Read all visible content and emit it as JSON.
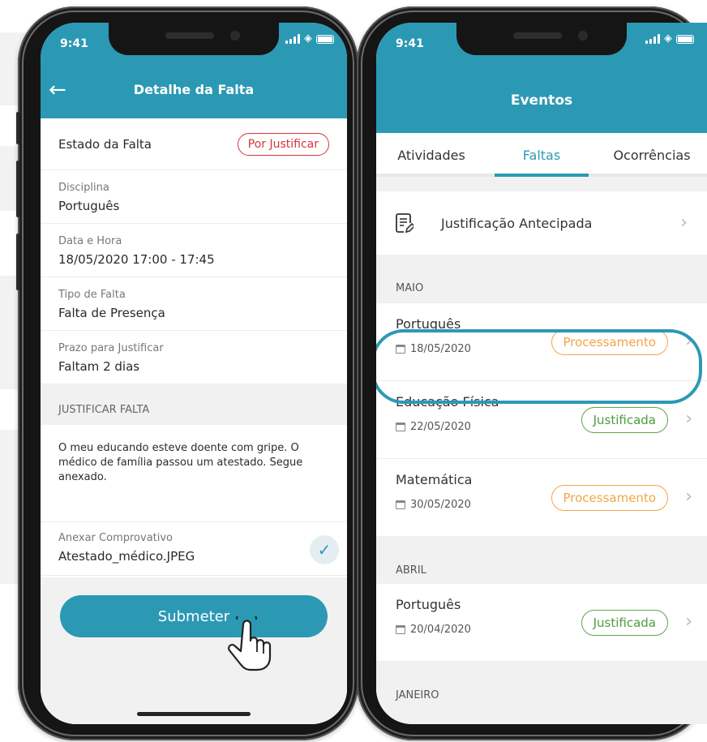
{
  "left_phone": {
    "status_time": "9:41",
    "header": {
      "back_icon": "arrow-left-icon",
      "title": "Detalhe da Falta"
    },
    "estado": {
      "label": "Estado da Falta",
      "badge": "Por Justificar",
      "badge_color": "#d6333f"
    },
    "fields": [
      {
        "label": "Disciplina",
        "value": "Português"
      },
      {
        "label": "Data e Hora",
        "value": "18/05/2020  17:00 - 17:45"
      },
      {
        "label": "Tipo de Falta",
        "value": "Falta de Presença"
      },
      {
        "label": "Prazo para Justificar",
        "value": "Faltam 2 dias"
      }
    ],
    "section_title": "JUSTIFICAR FALTA",
    "justification_text": "O meu educando esteve doente com gripe. O médico de família passou um atestado. Segue anexado.",
    "attachment": {
      "label": "Anexar Comprovativo",
      "value": "Atestado_médico.JPEG",
      "icon": "check-icon"
    },
    "submit_label": "Submeter"
  },
  "right_phone": {
    "status_time": "9:41",
    "header": {
      "title": "Eventos"
    },
    "tabs": [
      {
        "label": "Atividades"
      },
      {
        "label": "Faltas"
      },
      {
        "label": "Ocorrências"
      }
    ],
    "active_tab": "Faltas",
    "justificacao": {
      "label": "Justificação Antecipada",
      "icon": "document-edit-icon"
    },
    "months": [
      "MAIO",
      "ABRIL",
      "JANEIRO"
    ],
    "events": [
      {
        "name": "Português",
        "date": "18/05/2020",
        "status": "Processamento"
      },
      {
        "name": "Educação Física",
        "date": "22/05/2020",
        "status": "Justificada"
      },
      {
        "name": "Matemática",
        "date": "30/05/2020",
        "status": "Processamento"
      },
      {
        "name": "Português",
        "date": "20/04/2020",
        "status": "Justificada"
      }
    ]
  },
  "colors": {
    "accent": "#2b99b4",
    "processing": "#f3a54a",
    "justified": "#5aa848",
    "pending": "#d6333f"
  }
}
